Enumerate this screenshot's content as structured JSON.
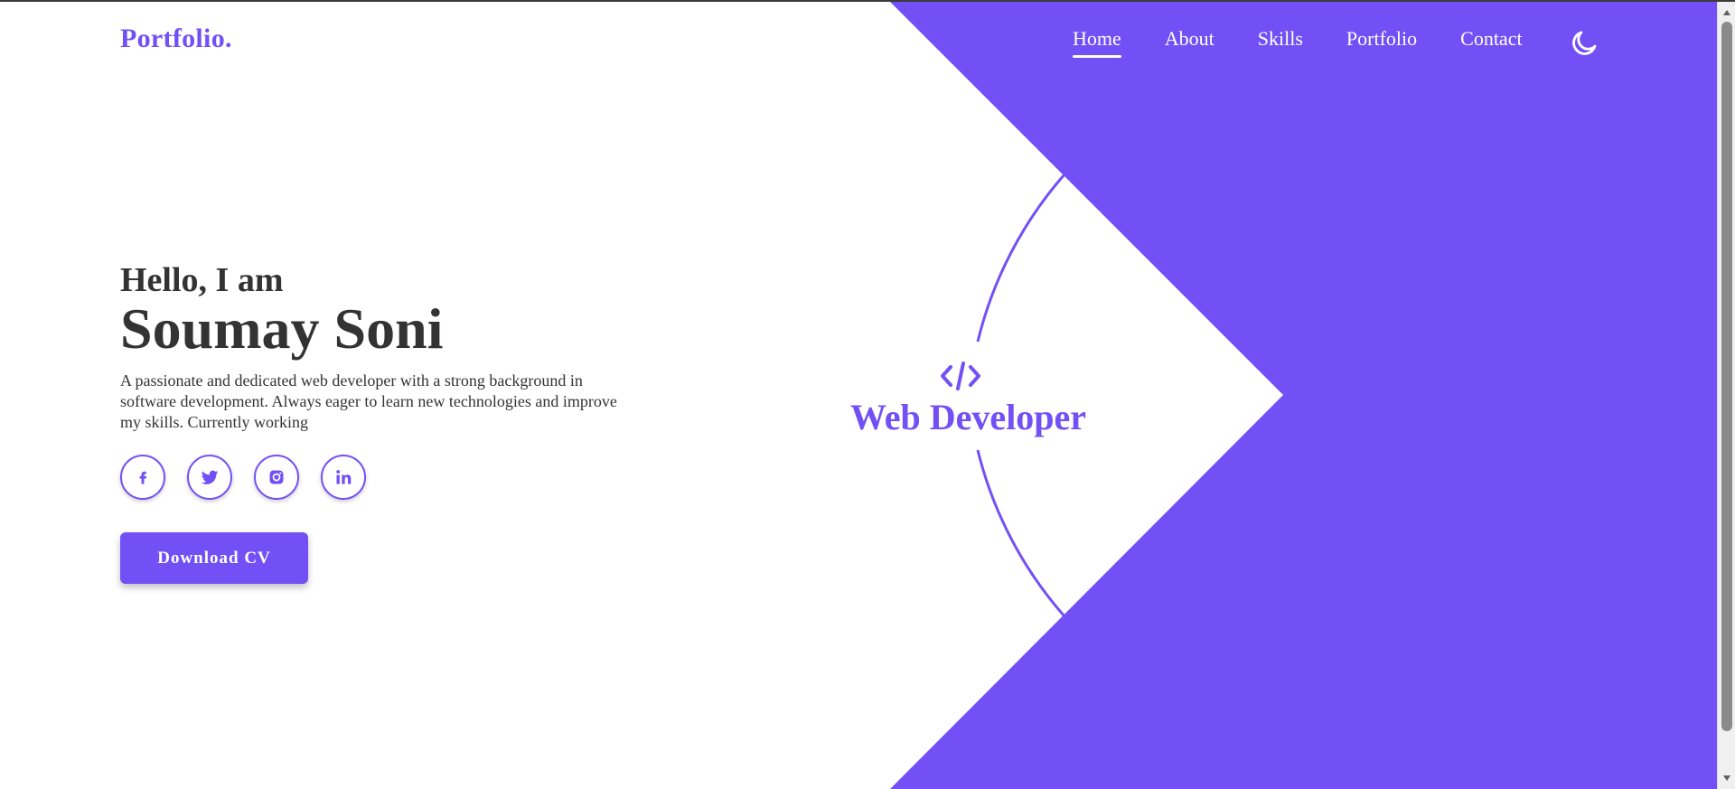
{
  "header": {
    "logo": "Portfolio.",
    "nav": [
      {
        "label": "Home",
        "active": true
      },
      {
        "label": "About",
        "active": false
      },
      {
        "label": "Skills",
        "active": false
      },
      {
        "label": "Portfolio",
        "active": false
      },
      {
        "label": "Contact",
        "active": false
      }
    ],
    "theme_icon": "moon-icon"
  },
  "hero": {
    "greeting": "Hello, I am",
    "name": "Soumay Soni",
    "description": "A passionate and dedicated web developer with a strong background in software development. Always eager to learn new technologies and improve my skills. Currently working",
    "socials": [
      {
        "icon": "facebook-icon"
      },
      {
        "icon": "twitter-icon"
      },
      {
        "icon": "instagram-icon"
      },
      {
        "icon": "linkedin-icon"
      }
    ],
    "cv_button": "Download CV"
  },
  "role": {
    "icon": "code-icon",
    "label": "Web Developer"
  },
  "colors": {
    "accent": "#7350f5",
    "text": "#333333",
    "background": "#ffffff"
  }
}
